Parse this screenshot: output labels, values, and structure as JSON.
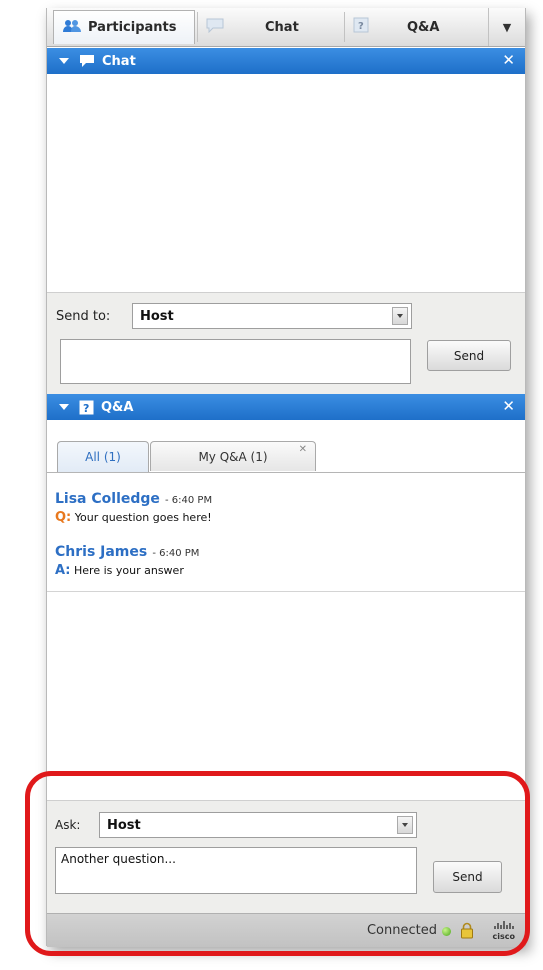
{
  "tabs": [
    {
      "label": "Participants",
      "icon": "participants-icon"
    },
    {
      "label": "Chat",
      "icon": "chat-bubble-icon"
    },
    {
      "label": "Q&A",
      "icon": "question-icon"
    }
  ],
  "chat_panel": {
    "title": "Chat",
    "send_to_label": "Send to:",
    "send_to_value": "Host",
    "message_value": "",
    "send_label": "Send"
  },
  "qa_panel": {
    "title": "Q&A",
    "subtabs": [
      {
        "label": "All (1)"
      },
      {
        "label": "My Q&A (1)"
      }
    ],
    "entries": [
      {
        "name": "Lisa Colledge",
        "time": "- 6:40 PM",
        "prefix": "Q:",
        "text": "Your question goes here!"
      },
      {
        "name": "Chris James",
        "time": "- 6:40 PM",
        "prefix": "A:",
        "text": "Here is your answer"
      }
    ],
    "ask_label": "Ask:",
    "ask_value": "Host",
    "question_value": "Another question...",
    "send_label": "Send"
  },
  "status": {
    "text": "Connected",
    "brand": "cisco"
  },
  "colors": {
    "header_blue": "#1e6fc9",
    "name_blue": "#2d6fc4",
    "question_orange": "#e8781e",
    "highlight_red": "#e0191b",
    "connected_green": "#4aa51a"
  }
}
